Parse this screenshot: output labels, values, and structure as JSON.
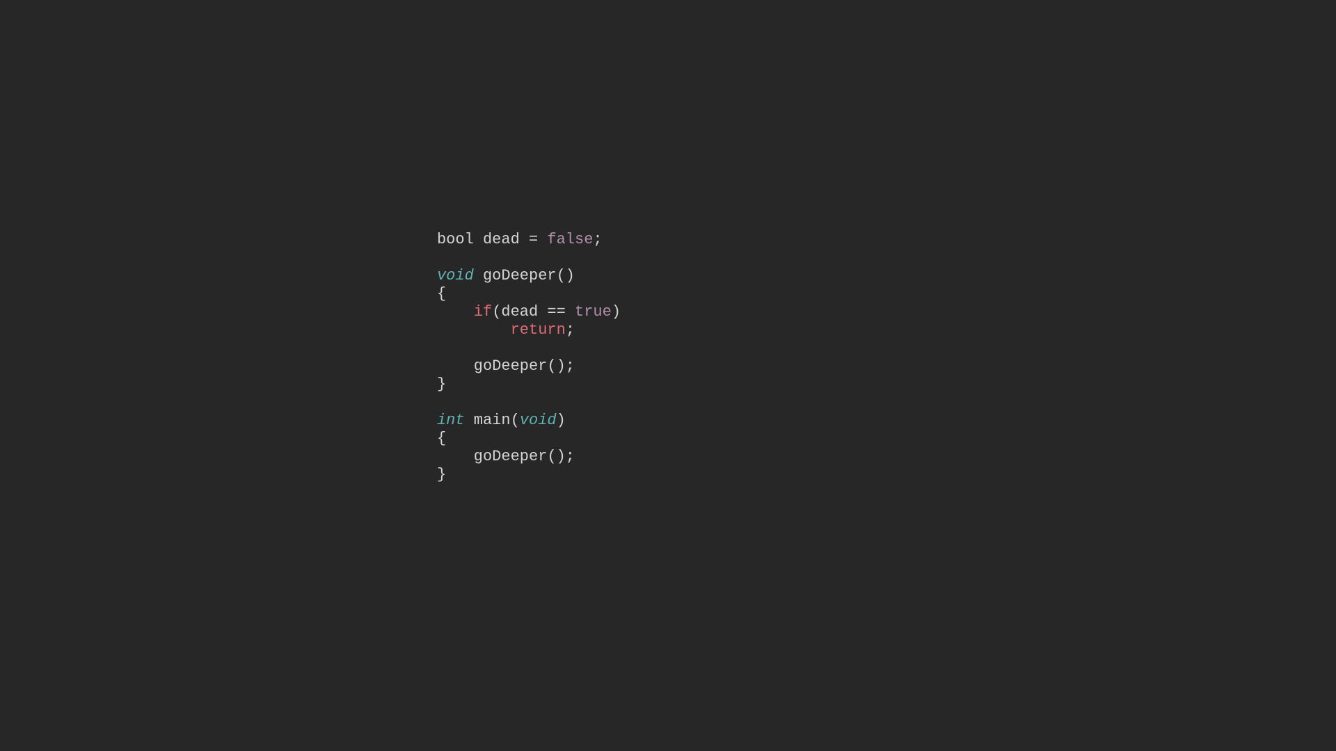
{
  "code": {
    "line1": {
      "type": "bool",
      "ident": "dead",
      "op": "=",
      "value": "false",
      "semi": ";"
    },
    "line3": {
      "type": "void",
      "func": "goDeeper",
      "parens": "()"
    },
    "line4": {
      "brace": "{"
    },
    "line5": {
      "keyword": "if",
      "open": "(",
      "ident": "dead",
      "op": "==",
      "value": "true",
      "close": ")"
    },
    "line6": {
      "keyword": "return",
      "semi": ";"
    },
    "line8": {
      "call": "goDeeper();"
    },
    "line9": {
      "brace": "}"
    },
    "line11": {
      "type": "int",
      "func": "main",
      "open": "(",
      "param": "void",
      "close": ")"
    },
    "line12": {
      "brace": "{"
    },
    "line13": {
      "call": "goDeeper();"
    },
    "line14": {
      "brace": "}"
    }
  }
}
